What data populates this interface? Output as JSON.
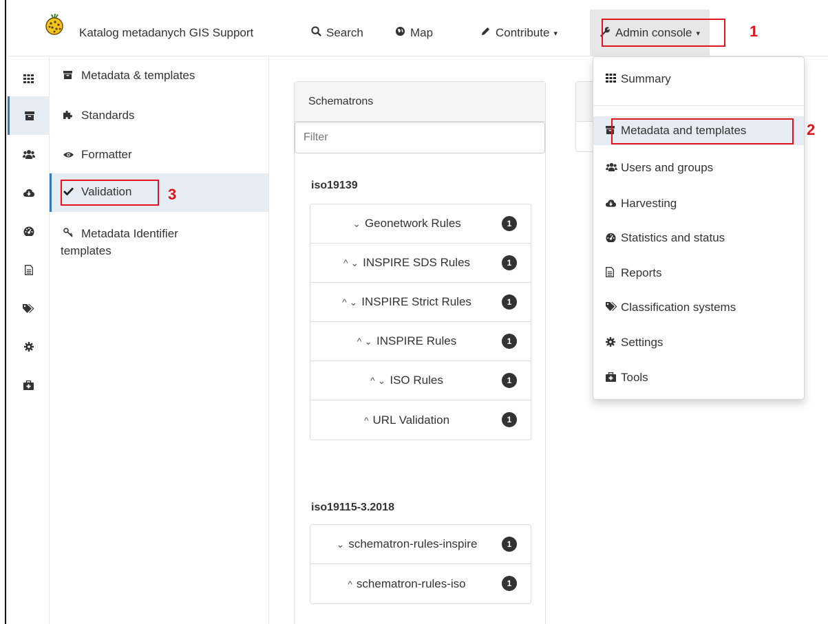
{
  "navbar": {
    "brand": "Katalog metadanych GIS Support",
    "search": "Search",
    "map": "Map",
    "contribute": "Contribute",
    "admin": "Admin console",
    "caret": "▾"
  },
  "annotations": {
    "one": "1",
    "two": "2",
    "three": "3"
  },
  "sidebar_icons": [
    "grid-icon",
    "archive-icon",
    "users-icon",
    "cloud-icon",
    "dashboard-icon",
    "report-icon",
    "tags-icon",
    "gear-icon",
    "toolbox-icon"
  ],
  "submenu": {
    "items": [
      {
        "label": "Metadata & templates",
        "icon": "archive-icon"
      },
      {
        "label": "Standards",
        "icon": "puzzle-icon"
      },
      {
        "label": "Formatter",
        "icon": "eye-icon"
      },
      {
        "label": "Validation",
        "icon": "check-icon"
      },
      {
        "label": "Metadata Identifier",
        "label2": "templates",
        "icon": "key-icon"
      }
    ]
  },
  "panel": {
    "title": "Schematrons",
    "filter_placeholder": "Filter",
    "groups": [
      {
        "title": "iso19139",
        "items": [
          {
            "label": "Geonetwork Rules",
            "arrows": "⌄",
            "count": "1"
          },
          {
            "label": "INSPIRE SDS Rules",
            "arrows": "^ ⌄",
            "count": "1"
          },
          {
            "label": "INSPIRE Strict Rules",
            "arrows": "^ ⌄",
            "count": "1"
          },
          {
            "label": "INSPIRE Rules",
            "arrows": "^ ⌄",
            "count": "1"
          },
          {
            "label": "ISO Rules",
            "arrows": "^ ⌄",
            "count": "1"
          },
          {
            "label": "URL Validation",
            "arrows": "^",
            "count": "1"
          }
        ]
      },
      {
        "title": "iso19115-3.2018",
        "items": [
          {
            "label": "schematron-rules-inspire",
            "arrows": "⌄",
            "count": "1"
          },
          {
            "label": "schematron-rules-iso",
            "arrows": "^",
            "count": "1"
          }
        ]
      }
    ]
  },
  "dropdown": {
    "items": [
      {
        "label": "Summary",
        "icon": "grid-icon"
      },
      {
        "label": "Metadata and templates",
        "icon": "archive-icon"
      },
      {
        "label": "Users and groups",
        "icon": "users-icon"
      },
      {
        "label": "Harvesting",
        "icon": "cloud-icon"
      },
      {
        "label": "Statistics and status",
        "icon": "dashboard-icon"
      },
      {
        "label": "Reports",
        "icon": "report-icon"
      },
      {
        "label": "Classification systems",
        "icon": "tags-icon"
      },
      {
        "label": "Settings",
        "icon": "gear-icon"
      },
      {
        "label": "Tools",
        "icon": "toolbox-icon"
      }
    ]
  },
  "colors": {
    "highlight": "#e1141c",
    "active_bg": "#e5ecf3",
    "accent": "#337ab7"
  }
}
